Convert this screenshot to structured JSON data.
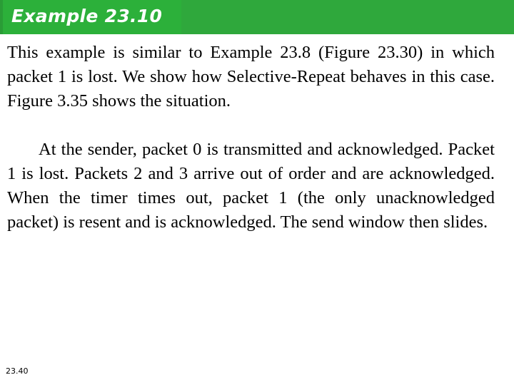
{
  "slide": {
    "title": "Example 23.10",
    "title_bar_color": "#2cb03a",
    "title_bar_color_right": "#2fa83c",
    "title_text_color": "#ffffff",
    "background_color": "#ffffff",
    "body_text_color": "#000000",
    "paragraphs": [
      {
        "id": "paragraph-1",
        "indent": false,
        "text": "This example is similar to Example 23.8 (Figure 23.30) in which packet 1 is lost. We show how Selective-Repeat behaves in this case. Figure 3.35 shows the situation."
      },
      {
        "id": "paragraph-2",
        "indent": true,
        "text": "At the sender, packet 0 is transmitted and acknowledged. Packet 1 is lost. Packets 2 and 3 arrive out of order and are acknowledged. When the timer times out, packet 1 (the only unacknowledged packet) is resent and is acknowledged. The send window then slides."
      }
    ],
    "footer": {
      "page_number": "23.40"
    }
  }
}
